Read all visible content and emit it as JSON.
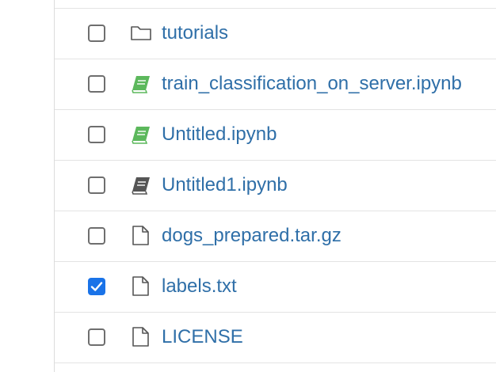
{
  "files": [
    {
      "name": "tutorials",
      "icon": "folder-icon",
      "checked": false
    },
    {
      "name": "train_classification_on_server.ipynb",
      "icon": "notebook-running-icon",
      "checked": false,
      "icon_color": "#5cb85c"
    },
    {
      "name": "Untitled.ipynb",
      "icon": "notebook-running-icon",
      "checked": false,
      "icon_color": "#5cb85c"
    },
    {
      "name": "Untitled1.ipynb",
      "icon": "notebook-icon",
      "checked": false,
      "icon_color": "#555555"
    },
    {
      "name": "dogs_prepared.tar.gz",
      "icon": "file-icon",
      "checked": false
    },
    {
      "name": "labels.txt",
      "icon": "file-icon",
      "checked": true
    },
    {
      "name": "LICENSE",
      "icon": "file-icon",
      "checked": false
    }
  ],
  "colors": {
    "link": "#2f6fa8",
    "checkbox_checked": "#1a73e8",
    "running_notebook": "#5cb85c",
    "idle_notebook": "#555555",
    "divider": "#e3e3e3"
  }
}
